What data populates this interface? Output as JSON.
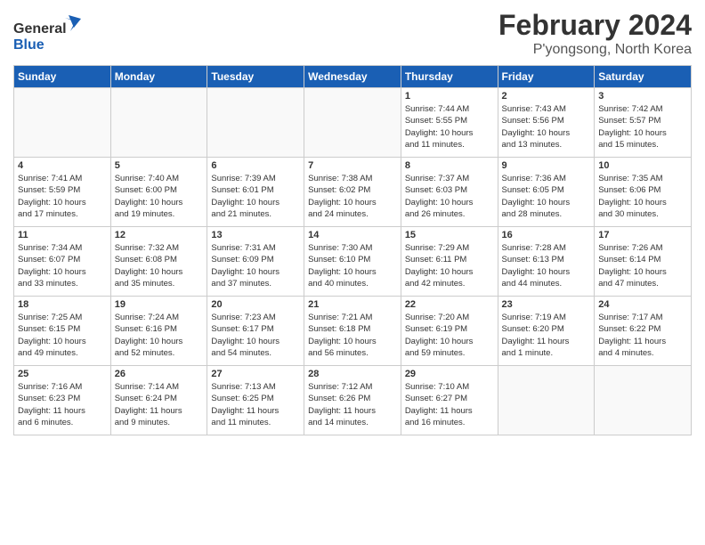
{
  "header": {
    "logo_line1": "General",
    "logo_line2": "Blue",
    "month": "February 2024",
    "location": "P'yongsong, North Korea"
  },
  "days_of_week": [
    "Sunday",
    "Monday",
    "Tuesday",
    "Wednesday",
    "Thursday",
    "Friday",
    "Saturday"
  ],
  "weeks": [
    [
      {
        "day": "",
        "info": ""
      },
      {
        "day": "",
        "info": ""
      },
      {
        "day": "",
        "info": ""
      },
      {
        "day": "",
        "info": ""
      },
      {
        "day": "1",
        "info": "Sunrise: 7:44 AM\nSunset: 5:55 PM\nDaylight: 10 hours\nand 11 minutes."
      },
      {
        "day": "2",
        "info": "Sunrise: 7:43 AM\nSunset: 5:56 PM\nDaylight: 10 hours\nand 13 minutes."
      },
      {
        "day": "3",
        "info": "Sunrise: 7:42 AM\nSunset: 5:57 PM\nDaylight: 10 hours\nand 15 minutes."
      }
    ],
    [
      {
        "day": "4",
        "info": "Sunrise: 7:41 AM\nSunset: 5:59 PM\nDaylight: 10 hours\nand 17 minutes."
      },
      {
        "day": "5",
        "info": "Sunrise: 7:40 AM\nSunset: 6:00 PM\nDaylight: 10 hours\nand 19 minutes."
      },
      {
        "day": "6",
        "info": "Sunrise: 7:39 AM\nSunset: 6:01 PM\nDaylight: 10 hours\nand 21 minutes."
      },
      {
        "day": "7",
        "info": "Sunrise: 7:38 AM\nSunset: 6:02 PM\nDaylight: 10 hours\nand 24 minutes."
      },
      {
        "day": "8",
        "info": "Sunrise: 7:37 AM\nSunset: 6:03 PM\nDaylight: 10 hours\nand 26 minutes."
      },
      {
        "day": "9",
        "info": "Sunrise: 7:36 AM\nSunset: 6:05 PM\nDaylight: 10 hours\nand 28 minutes."
      },
      {
        "day": "10",
        "info": "Sunrise: 7:35 AM\nSunset: 6:06 PM\nDaylight: 10 hours\nand 30 minutes."
      }
    ],
    [
      {
        "day": "11",
        "info": "Sunrise: 7:34 AM\nSunset: 6:07 PM\nDaylight: 10 hours\nand 33 minutes."
      },
      {
        "day": "12",
        "info": "Sunrise: 7:32 AM\nSunset: 6:08 PM\nDaylight: 10 hours\nand 35 minutes."
      },
      {
        "day": "13",
        "info": "Sunrise: 7:31 AM\nSunset: 6:09 PM\nDaylight: 10 hours\nand 37 minutes."
      },
      {
        "day": "14",
        "info": "Sunrise: 7:30 AM\nSunset: 6:10 PM\nDaylight: 10 hours\nand 40 minutes."
      },
      {
        "day": "15",
        "info": "Sunrise: 7:29 AM\nSunset: 6:11 PM\nDaylight: 10 hours\nand 42 minutes."
      },
      {
        "day": "16",
        "info": "Sunrise: 7:28 AM\nSunset: 6:13 PM\nDaylight: 10 hours\nand 44 minutes."
      },
      {
        "day": "17",
        "info": "Sunrise: 7:26 AM\nSunset: 6:14 PM\nDaylight: 10 hours\nand 47 minutes."
      }
    ],
    [
      {
        "day": "18",
        "info": "Sunrise: 7:25 AM\nSunset: 6:15 PM\nDaylight: 10 hours\nand 49 minutes."
      },
      {
        "day": "19",
        "info": "Sunrise: 7:24 AM\nSunset: 6:16 PM\nDaylight: 10 hours\nand 52 minutes."
      },
      {
        "day": "20",
        "info": "Sunrise: 7:23 AM\nSunset: 6:17 PM\nDaylight: 10 hours\nand 54 minutes."
      },
      {
        "day": "21",
        "info": "Sunrise: 7:21 AM\nSunset: 6:18 PM\nDaylight: 10 hours\nand 56 minutes."
      },
      {
        "day": "22",
        "info": "Sunrise: 7:20 AM\nSunset: 6:19 PM\nDaylight: 10 hours\nand 59 minutes."
      },
      {
        "day": "23",
        "info": "Sunrise: 7:19 AM\nSunset: 6:20 PM\nDaylight: 11 hours\nand 1 minute."
      },
      {
        "day": "24",
        "info": "Sunrise: 7:17 AM\nSunset: 6:22 PM\nDaylight: 11 hours\nand 4 minutes."
      }
    ],
    [
      {
        "day": "25",
        "info": "Sunrise: 7:16 AM\nSunset: 6:23 PM\nDaylight: 11 hours\nand 6 minutes."
      },
      {
        "day": "26",
        "info": "Sunrise: 7:14 AM\nSunset: 6:24 PM\nDaylight: 11 hours\nand 9 minutes."
      },
      {
        "day": "27",
        "info": "Sunrise: 7:13 AM\nSunset: 6:25 PM\nDaylight: 11 hours\nand 11 minutes."
      },
      {
        "day": "28",
        "info": "Sunrise: 7:12 AM\nSunset: 6:26 PM\nDaylight: 11 hours\nand 14 minutes."
      },
      {
        "day": "29",
        "info": "Sunrise: 7:10 AM\nSunset: 6:27 PM\nDaylight: 11 hours\nand 16 minutes."
      },
      {
        "day": "",
        "info": ""
      },
      {
        "day": "",
        "info": ""
      }
    ]
  ]
}
